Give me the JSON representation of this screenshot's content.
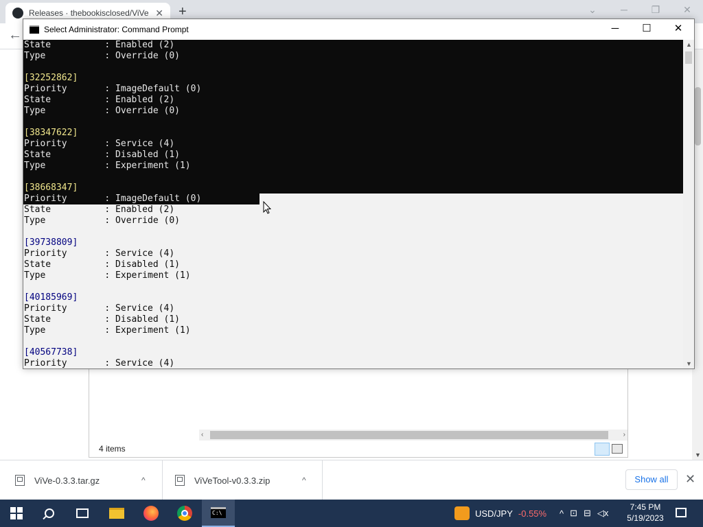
{
  "browser": {
    "tab_title": "Releases · thebookisclosed/ViVe",
    "tab_close": "✕",
    "new_tab": "+",
    "window_controls": [
      "⌄",
      "─",
      "❐",
      "✕"
    ],
    "back": "←"
  },
  "explorer": {
    "status": "4 items"
  },
  "cmd": {
    "title": "Select Administrator:  Command Prompt",
    "controls": {
      "minimize": "─",
      "maximize": "☐",
      "close": "✕"
    },
    "selected_lines": [
      {
        "text": "State          : Enabled (2)",
        "hdr": false
      },
      {
        "text": "Type           : Override (0)",
        "hdr": false
      },
      {
        "text": "",
        "hdr": false
      },
      {
        "text": "[32252862]",
        "hdr": true
      },
      {
        "text": "Priority       : ImageDefault (0)",
        "hdr": false
      },
      {
        "text": "State          : Enabled (2)",
        "hdr": false
      },
      {
        "text": "Type           : Override (0)",
        "hdr": false
      },
      {
        "text": "",
        "hdr": false
      },
      {
        "text": "[38347622]",
        "hdr": true
      },
      {
        "text": "Priority       : Service (4)",
        "hdr": false
      },
      {
        "text": "State          : Disabled (1)",
        "hdr": false
      },
      {
        "text": "Type           : Experiment (1)",
        "hdr": false
      },
      {
        "text": "",
        "hdr": false
      },
      {
        "text": "[38668347]",
        "hdr": true
      },
      {
        "text": "Priority       : ImageDefault (0)",
        "hdr": false
      }
    ],
    "lines": [
      {
        "text": "State          : Enabled (2)",
        "hdr": false
      },
      {
        "text": "Type           : Override (0)",
        "hdr": false
      },
      {
        "text": "",
        "hdr": false
      },
      {
        "text": "[39738809]",
        "hdr": true
      },
      {
        "text": "Priority       : Service (4)",
        "hdr": false
      },
      {
        "text": "State          : Disabled (1)",
        "hdr": false
      },
      {
        "text": "Type           : Experiment (1)",
        "hdr": false
      },
      {
        "text": "",
        "hdr": false
      },
      {
        "text": "[40185969]",
        "hdr": true
      },
      {
        "text": "Priority       : Service (4)",
        "hdr": false
      },
      {
        "text": "State          : Disabled (1)",
        "hdr": false
      },
      {
        "text": "Type           : Experiment (1)",
        "hdr": false
      },
      {
        "text": "",
        "hdr": false
      },
      {
        "text": "[40567738]",
        "hdr": true
      },
      {
        "text": "Priority       : Service (4)",
        "hdr": false
      }
    ]
  },
  "downloads": {
    "items": [
      {
        "name": "ViVe-0.3.3.tar.gz"
      },
      {
        "name": "ViVeTool-v0.3.3.zip"
      }
    ],
    "show_all": "Show all",
    "close": "✕",
    "chevron": "^"
  },
  "taskbar": {
    "ticker_symbol": "USD/JPY",
    "ticker_change": "-0.55%",
    "ticker_change_color": "#ff6b6b",
    "time": "7:45 PM",
    "date": "5/19/2023",
    "tray_icons": [
      "chevron-up-icon",
      "network-icon",
      "wifi-icon",
      "volume-muted-icon"
    ]
  }
}
